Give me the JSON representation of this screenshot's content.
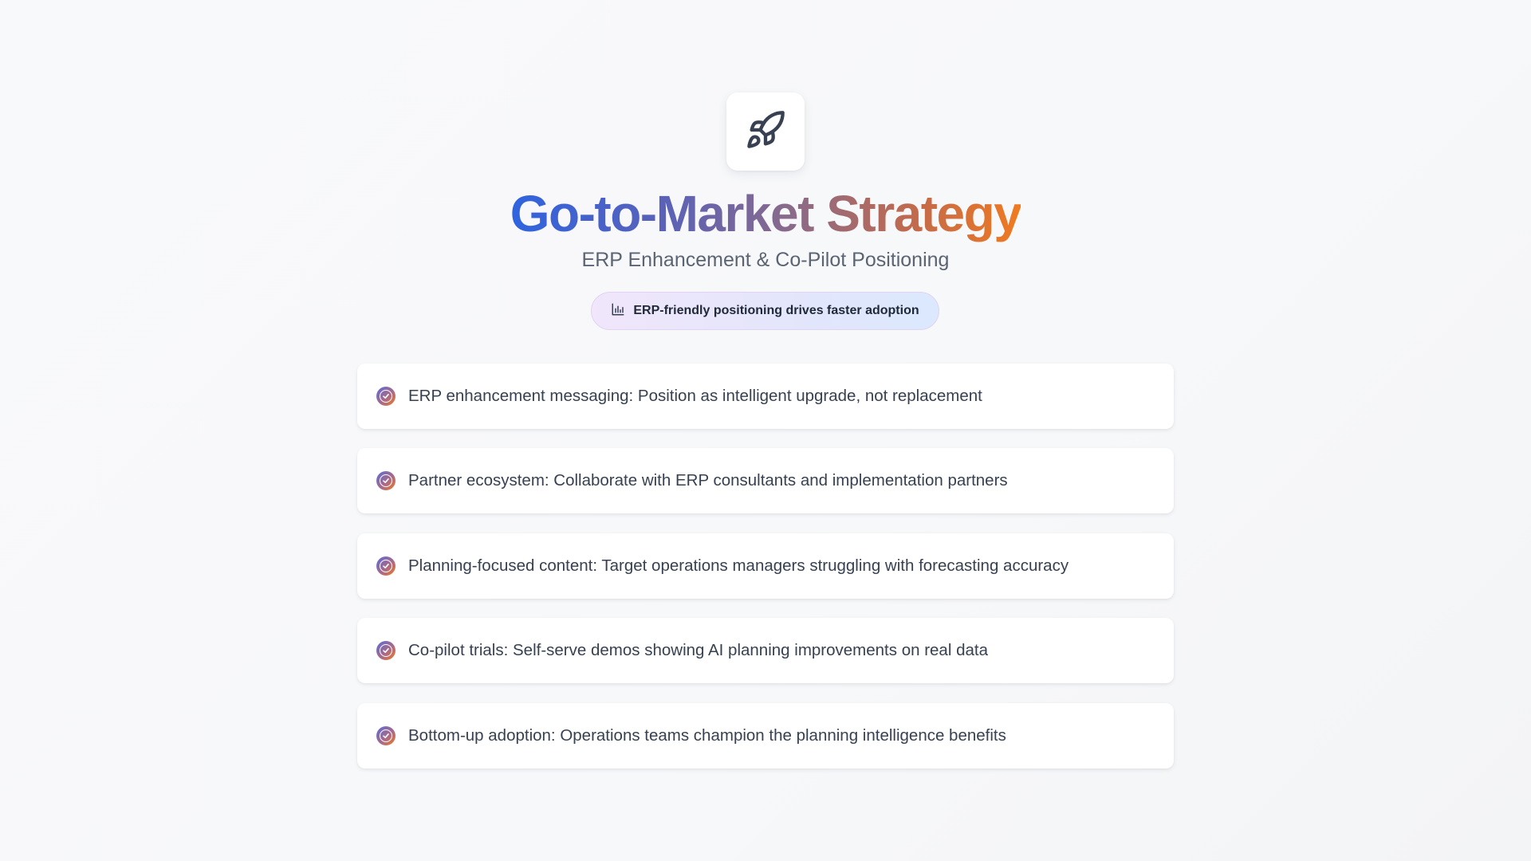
{
  "header": {
    "icon": "rocket-icon",
    "title": "Go-to-Market Strategy",
    "subtitle": "ERP Enhancement & Co-Pilot Positioning"
  },
  "badge": {
    "icon": "bar-chart-icon",
    "text": "ERP-friendly positioning drives faster adoption"
  },
  "items": [
    {
      "icon": "check-circle-icon",
      "text": "ERP enhancement messaging: Position as intelligent upgrade, not replacement"
    },
    {
      "icon": "check-circle-icon",
      "text": "Partner ecosystem: Collaborate with ERP consultants and implementation partners"
    },
    {
      "icon": "check-circle-icon",
      "text": "Planning-focused content: Target operations managers struggling with forecasting accuracy"
    },
    {
      "icon": "check-circle-icon",
      "text": "Co-pilot trials: Self-serve demos showing AI planning improvements on real data"
    },
    {
      "icon": "check-circle-icon",
      "text": "Bottom-up adoption: Operations teams champion the planning intelligence benefits"
    }
  ],
  "colors": {
    "title_gradient_start": "#2f63e0",
    "title_gradient_end": "#f07a20",
    "text": "#374151",
    "subtitle": "#5b6472"
  }
}
